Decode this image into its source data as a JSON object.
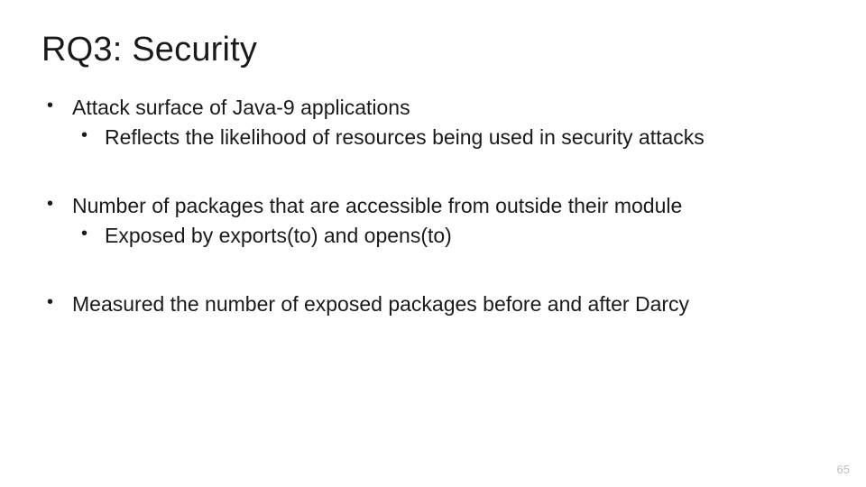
{
  "title": "RQ3: Security",
  "bullets": [
    {
      "text": "Attack surface of Java-9 applications",
      "sub": [
        {
          "text": "Reflects the likelihood of resources being used in security attacks"
        }
      ]
    },
    {
      "text": "Number of packages that are accessible from outside their module",
      "sub": [
        {
          "text": "Exposed by exports(to) and opens(to)"
        }
      ]
    },
    {
      "text": "Measured the number of exposed packages before and after Darcy",
      "sub": []
    }
  ],
  "page_number": "65"
}
